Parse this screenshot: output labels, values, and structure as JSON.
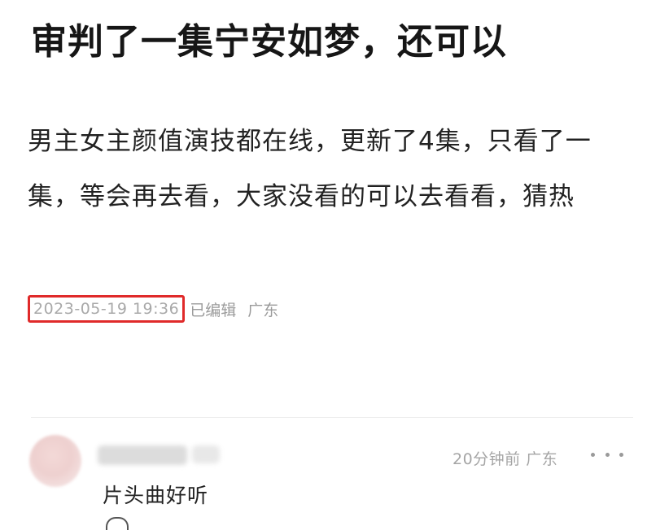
{
  "post": {
    "title": "审判了一集宁安如梦，还可以",
    "body": "男主女主颜值演技都在线，更新了4集，只看了一集，等会再去看，大家没看的可以去看看，猜热",
    "timestamp": "2023-05-19 19:36",
    "edited_label": "已编辑",
    "location": "广东"
  },
  "comment": {
    "time_location": "20分钟前 广东",
    "text": "片头曲好听",
    "more_icon": "more-dots-icon"
  },
  "colors": {
    "highlight_box": "#e02a2a",
    "meta_text": "#9b9b9b"
  }
}
